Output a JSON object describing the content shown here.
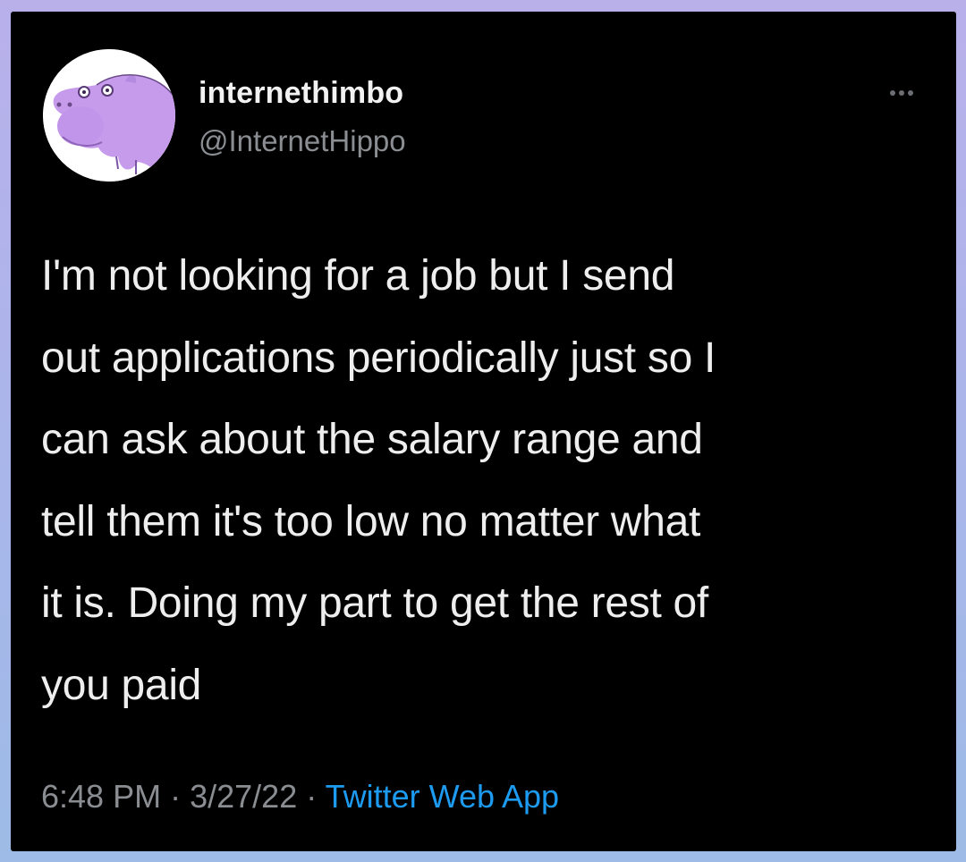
{
  "tweet": {
    "display_name": "internethimbo",
    "handle": "@InternetHippo",
    "text_lines": [
      "I'm not looking for a job but I send",
      "out applications periodically just so I",
      "can ask about the salary range and",
      "tell them it's too low no matter what",
      "it is. Doing my part to get the rest of",
      "you paid"
    ],
    "time": "6:48 PM",
    "separator": "·",
    "date": "3/27/22",
    "source": "Twitter Web App",
    "avatar_icon": "hippo-avatar-icon",
    "more_icon": "more-options-icon"
  },
  "colors": {
    "background": "#000000",
    "frame": "#b4b4ea",
    "text": "#eeeeee",
    "muted": "#8a8d91",
    "link": "#1d9bf0",
    "avatar_purple": "#c79bec"
  }
}
